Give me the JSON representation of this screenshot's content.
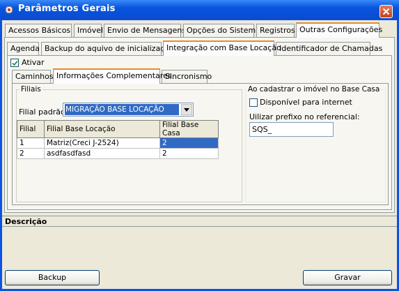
{
  "window": {
    "title": "Parâmetros Gerais"
  },
  "main_tabs": [
    {
      "label": "Acessos Básicos"
    },
    {
      "label": "Imóvel"
    },
    {
      "label": "Envio de Mensagens"
    },
    {
      "label": "Opções do Sistema"
    },
    {
      "label": "Registros"
    },
    {
      "label": "Outras Configurações"
    }
  ],
  "sub_tabs": [
    {
      "label": "Agenda"
    },
    {
      "label": "Backup do aquivo de inicialização"
    },
    {
      "label": "Integração com Base Locação"
    },
    {
      "label": "Identificador de Chamadas"
    }
  ],
  "ativar": {
    "label": "Ativar",
    "checked": true
  },
  "inner_tabs": [
    {
      "label": "Caminhos"
    },
    {
      "label": "Informações Complementares"
    },
    {
      "label": "Sincronismo"
    }
  ],
  "filiais": {
    "legend": "Filiais",
    "filial_padrao_label": "Filial padrão:",
    "filial_padrao_value": "MIGRAÇÃO BASE LOCAÇÃO",
    "columns": [
      "Filial",
      "Filial Base Locação",
      "Filial Base Casa"
    ],
    "rows": [
      {
        "filial": "1",
        "base_locacao": "Matriz(Creci J-2524)",
        "base_casa": "2"
      },
      {
        "filial": "2",
        "base_locacao": "asdfasdfasd",
        "base_casa": "2"
      }
    ]
  },
  "base_casa": {
    "legend": "Ao cadastrar o imóvel no Base Casa",
    "disponivel_label": "Disponível para internet",
    "disponivel_checked": false,
    "prefixo_label": "Uilizar prefixo no referencial:",
    "prefixo_value": "SQS_"
  },
  "descricao": {
    "label": "Descrição"
  },
  "buttons": {
    "backup": "Backup",
    "gravar": "Gravar"
  },
  "colors": {
    "titlebar": "#0855dd",
    "selected_row": "#316ac5",
    "tab_highlight": "#e68b2c",
    "face": "#ece9d8"
  }
}
